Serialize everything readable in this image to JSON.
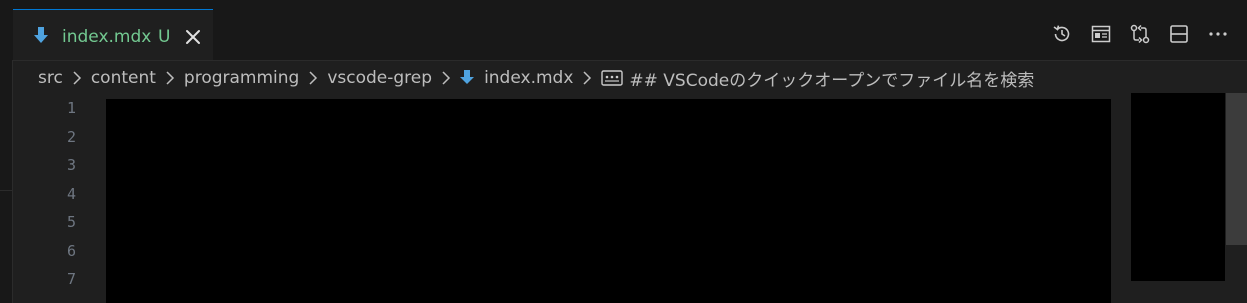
{
  "colors": {
    "accent": "#0078d4",
    "untracked": "#73c991",
    "file_icon": "#4fa3e0"
  },
  "tab": {
    "label": "index.mdx",
    "status": "U",
    "icon": "markdown-download-icon"
  },
  "editor_actions": [
    "history-icon",
    "open-preview-icon",
    "compare-changes-icon",
    "split-editor-icon",
    "more-actions-icon"
  ],
  "breadcrumb": {
    "items": [
      "src",
      "content",
      "programming",
      "vscode-grep",
      "index.mdx"
    ],
    "symbol": "## VSCodeのクイックオープンでファイル名を検索"
  },
  "line_numbers": [
    "1",
    "2",
    "3",
    "4",
    "5",
    "6",
    "7"
  ]
}
